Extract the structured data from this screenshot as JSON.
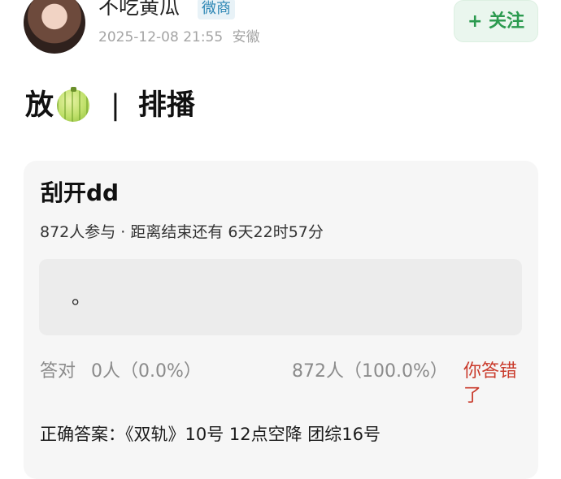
{
  "post": {
    "user_name": "不吃黄瓜",
    "badge": "微商",
    "timestamp": "2025-12-08 21:55",
    "location": "安徽",
    "follow_label": "+ 关注",
    "text_before": "放",
    "separator": "|",
    "text_after": "排播"
  },
  "vote": {
    "title": "刮开dd",
    "participants": "872人参与",
    "dot": " · ",
    "countdown": "距离结束还有 6天22时57分",
    "option_text": "。",
    "correct_label": "答对",
    "correct_stat": "0人（0.0%）",
    "other_stat": "872人（100.0%）",
    "result_label": "你答错了",
    "answer_label": "正确答案：",
    "answer_value": "《双轨》10号 12点空降 团综16号"
  },
  "colors": {
    "accent_green": "#2b9a4f",
    "badge_blue": "#2c86b4",
    "error_red": "#c93a2b"
  },
  "icons": {
    "melon": "melon-emoji-icon",
    "avatar": "user-avatar"
  }
}
